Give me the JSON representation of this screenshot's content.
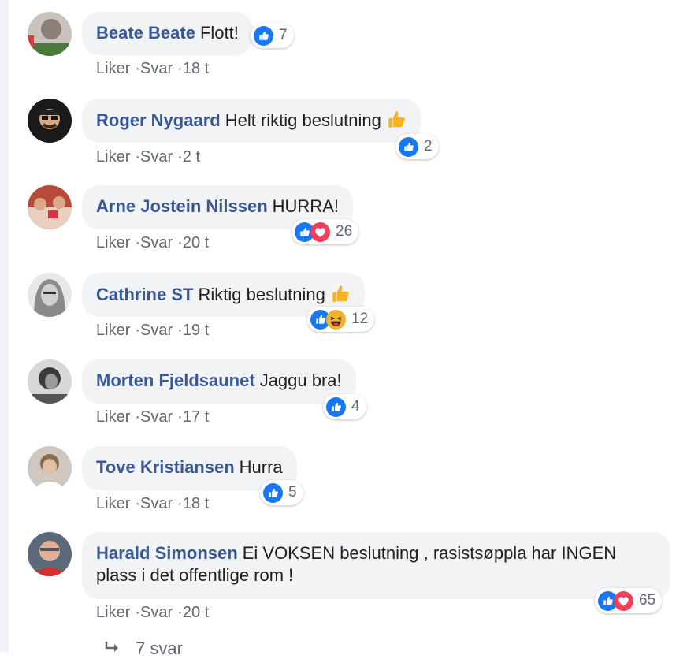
{
  "comments": [
    {
      "author": "Beate Beate",
      "text": "Flott!",
      "thumb": false,
      "reactions": [
        "like"
      ],
      "count": "7",
      "time": "18 t"
    },
    {
      "author": "Roger Nygaard",
      "text": "Helt riktig beslutning",
      "thumb": true,
      "reactions": [
        "like"
      ],
      "count": "2",
      "time": "2 t"
    },
    {
      "author": "Arne Jostein Nilssen",
      "text": "HURRA!",
      "thumb": false,
      "reactions": [
        "like",
        "love"
      ],
      "count": "26",
      "time": "20 t"
    },
    {
      "author": "Cathrine ST",
      "text": "Riktig beslutning",
      "thumb": true,
      "reactions": [
        "like",
        "haha"
      ],
      "count": "12",
      "time": "19 t"
    },
    {
      "author": "Morten Fjeldsaunet",
      "text": "Jaggu bra!",
      "thumb": false,
      "reactions": [
        "like"
      ],
      "count": "4",
      "time": "17 t"
    },
    {
      "author": "Tove Kristiansen",
      "text": "Hurra",
      "thumb": false,
      "reactions": [
        "like"
      ],
      "count": "5",
      "time": "18 t"
    },
    {
      "author": "Harald Simonsen",
      "text": "Ei VOKSEN beslutning , rasistsøppla har INGEN plass i det offentlige rom !",
      "thumb": false,
      "reactions": [
        "like",
        "love"
      ],
      "count": "65",
      "time": "20 t"
    }
  ],
  "actions": {
    "like": "Liker",
    "reply": "Svar",
    "sep": "·"
  },
  "more_replies": "7 svar",
  "colors": {
    "author": "#385898",
    "bubble": "#f2f3f5",
    "meta": "#606770",
    "like": "#1877f2",
    "love": "#f33e58",
    "haha": "#f7b125"
  }
}
